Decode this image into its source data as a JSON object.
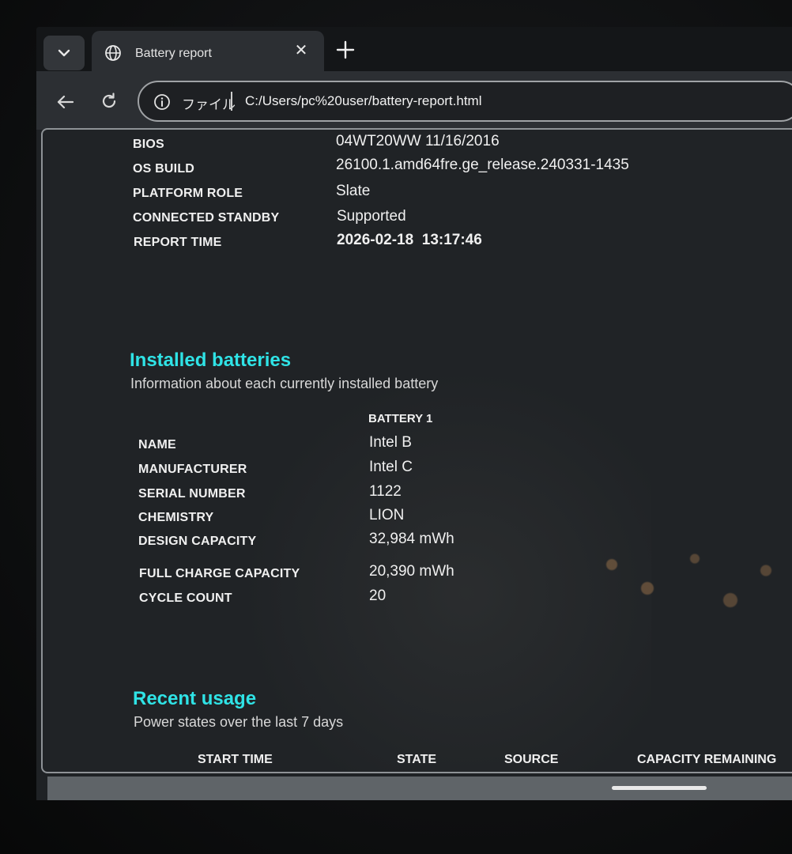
{
  "browser": {
    "tab": {
      "title": "Battery report",
      "close_glyph": "✕"
    },
    "address": {
      "scheme_label": "ファイル",
      "url": "C:/Users/pc%20user/battery-report.html"
    }
  },
  "system_info": [
    {
      "label": "BIOS",
      "value": "04WT20WW 11/16/2016"
    },
    {
      "label": "OS BUILD",
      "value": "26100.1.amd64fre.ge_release.240331-1435"
    },
    {
      "label": "PLATFORM ROLE",
      "value": "Slate"
    },
    {
      "label": "CONNECTED STANDBY",
      "value": "Supported"
    },
    {
      "label": "REPORT TIME",
      "value": "2026-02-18  13:17:46"
    }
  ],
  "installed_batteries": {
    "title": "Installed batteries",
    "subtitle": "Information about each currently installed battery",
    "column_header": "BATTERY 1",
    "rows": [
      {
        "label": "NAME",
        "value": "Intel B"
      },
      {
        "label": "MANUFACTURER",
        "value": "Intel C"
      },
      {
        "label": "SERIAL NUMBER",
        "value": "1122"
      },
      {
        "label": "CHEMISTRY",
        "value": "LION"
      },
      {
        "label": "DESIGN CAPACITY",
        "value": "32,984 mWh"
      },
      {
        "label": "FULL CHARGE CAPACITY",
        "value": "20,390 mWh"
      },
      {
        "label": "CYCLE COUNT",
        "value": "20"
      }
    ]
  },
  "recent_usage": {
    "title": "Recent usage",
    "subtitle": "Power states over the last 7 days",
    "columns": [
      "START TIME",
      "STATE",
      "SOURCE",
      "CAPACITY REMAINING"
    ]
  },
  "icons": {
    "tab_menu": "chevron-down-icon",
    "tab_favicon": "globe-icon",
    "new_tab": "plus-icon",
    "back": "arrow-left-icon",
    "reload": "reload-icon",
    "site_info": "info-icon"
  },
  "colors": {
    "section_title": "#2fe3e6",
    "text": "#f0f0f0",
    "page_background": "#202326"
  }
}
